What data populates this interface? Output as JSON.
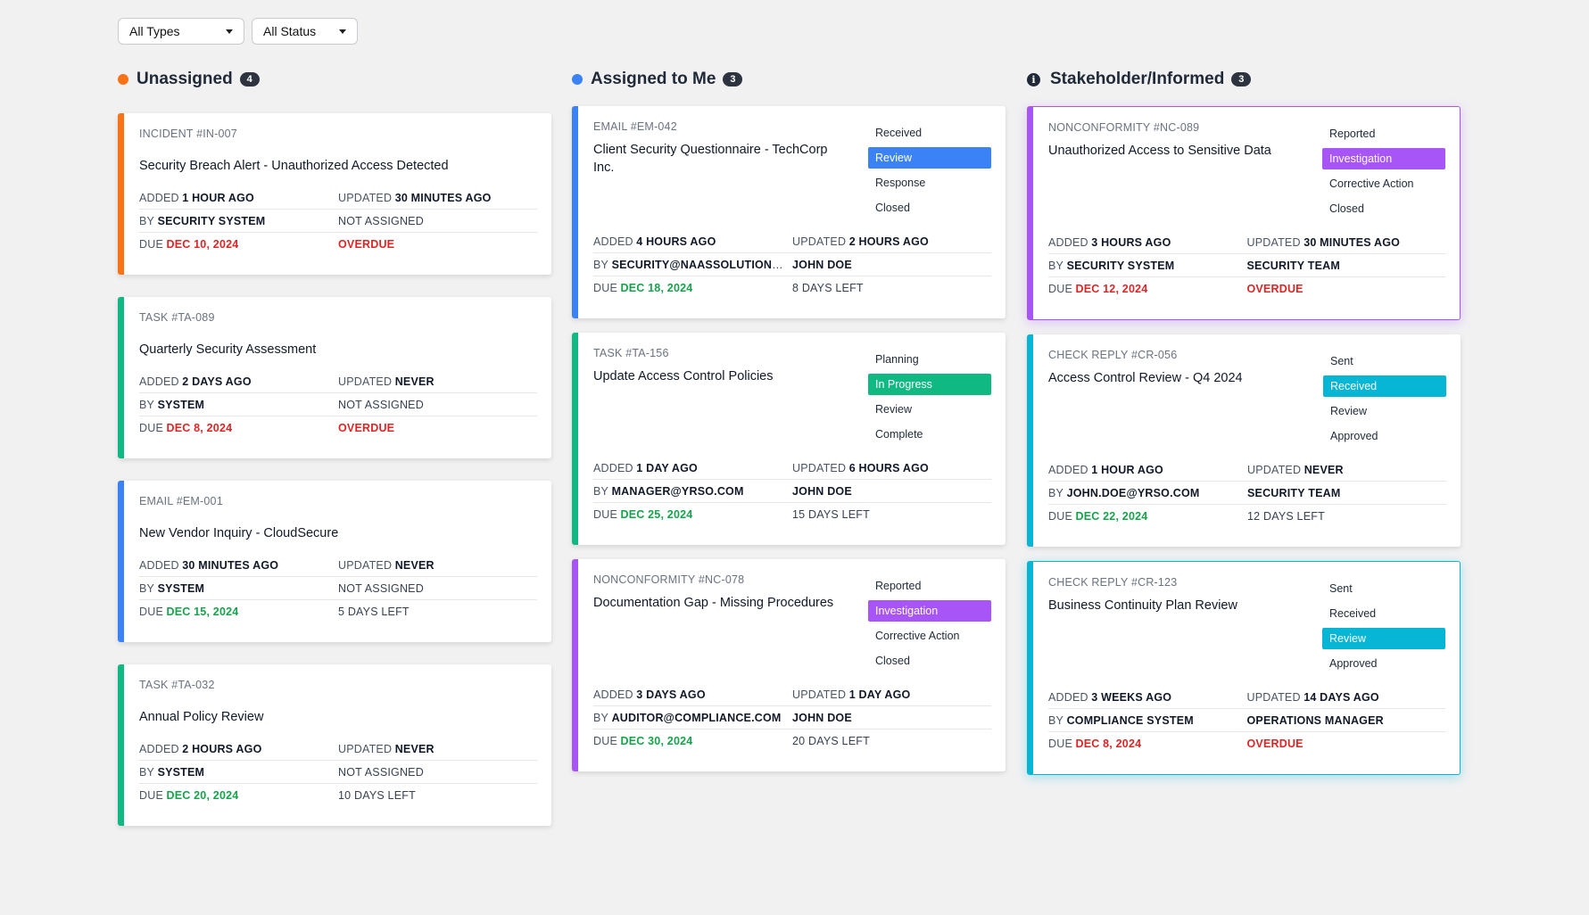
{
  "colors": {
    "orange": "#f97316",
    "blue": "#3b82f6",
    "green": "#10b981",
    "purple": "#a855f7",
    "cyan": "#06b6d4",
    "red": "#dc2626",
    "due_green": "#16a34a"
  },
  "filters": {
    "type": "All Types",
    "status": "All Status"
  },
  "columns": [
    {
      "title": "Unassigned",
      "count": "4",
      "icon": "orange-dot-icon",
      "cards": [
        {
          "id": "INCIDENT #IN-007",
          "title": "Security Breach Alert - Unauthorized Access Detected",
          "added_label": "ADDED",
          "added": "1 HOUR AGO",
          "updated_label": "UPDATED",
          "updated": "30 MINUTES AGO",
          "by_label": "BY",
          "by": "SECURITY SYSTEM",
          "assignee": "NOT ASSIGNED",
          "due_label": "DUE",
          "due": "DEC 10, 2024",
          "status": "OVERDUE"
        },
        {
          "id": "TASK #TA-089",
          "title": "Quarterly Security Assessment",
          "added_label": "ADDED",
          "added": "2 DAYS AGO",
          "updated_label": "UPDATED",
          "updated": "NEVER",
          "by_label": "BY",
          "by": "SYSTEM",
          "assignee": "NOT ASSIGNED",
          "due_label": "DUE",
          "due": "DEC 8, 2024",
          "status": "OVERDUE"
        },
        {
          "id": "EMAIL #EM-001",
          "title": "New Vendor Inquiry - CloudSecure",
          "added_label": "ADDED",
          "added": "30 MINUTES AGO",
          "updated_label": "UPDATED",
          "updated": "NEVER",
          "by_label": "BY",
          "by": "SYSTEM",
          "assignee": "NOT ASSIGNED",
          "due_label": "DUE",
          "due": "DEC 15, 2024",
          "status": "5 DAYS LEFT"
        },
        {
          "id": "TASK #TA-032",
          "title": "Annual Policy Review",
          "added_label": "ADDED",
          "added": "2 HOURS AGO",
          "updated_label": "UPDATED",
          "updated": "NEVER",
          "by_label": "BY",
          "by": "SYSTEM",
          "assignee": "NOT ASSIGNED",
          "due_label": "DUE",
          "due": "DEC 20, 2024",
          "status": "10 DAYS LEFT"
        }
      ]
    },
    {
      "title": "Assigned to Me",
      "count": "3",
      "icon": "blue-dot-icon",
      "cards": [
        {
          "id": "EMAIL #EM-042",
          "title": "Client Security Questionnaire - TechCorp Inc.",
          "steps": [
            "Received",
            "Review",
            "Response",
            "Closed"
          ],
          "active_step": "Review",
          "added_label": "ADDED",
          "added": "4 HOURS AGO",
          "updated_label": "UPDATED",
          "updated": "2 HOURS AGO",
          "by_label": "BY",
          "by": "SECURITY@NAASSOLUTIONS.C...",
          "assignee": "JOHN DOE",
          "due_label": "DUE",
          "due": "DEC 18, 2024",
          "status": "8 DAYS LEFT"
        },
        {
          "id": "TASK #TA-156",
          "title": "Update Access Control Policies",
          "steps": [
            "Planning",
            "In Progress",
            "Review",
            "Complete"
          ],
          "active_step": "In Progress",
          "added_label": "ADDED",
          "added": "1 DAY AGO",
          "updated_label": "UPDATED",
          "updated": "6 HOURS AGO",
          "by_label": "BY",
          "by": "MANAGER@YRSO.COM",
          "assignee": "JOHN DOE",
          "due_label": "DUE",
          "due": "DEC 25, 2024",
          "status": "15 DAYS LEFT"
        },
        {
          "id": "NONCONFORMITY #NC-078",
          "title": "Documentation Gap - Missing Procedures",
          "steps": [
            "Reported",
            "Investigation",
            "Corrective Action",
            "Closed"
          ],
          "active_step": "Investigation",
          "added_label": "ADDED",
          "added": "3 DAYS AGO",
          "updated_label": "UPDATED",
          "updated": "1 DAY AGO",
          "by_label": "BY",
          "by": "AUDITOR@COMPLIANCE.COM",
          "assignee": "JOHN DOE",
          "due_label": "DUE",
          "due": "DEC 30, 2024",
          "status": "20 DAYS LEFT"
        }
      ]
    },
    {
      "title": "Stakeholder/Informed",
      "count": "3",
      "icon": "info-icon",
      "cards": [
        {
          "id": "NONCONFORMITY #NC-089",
          "title": "Unauthorized Access to Sensitive Data",
          "steps": [
            "Reported",
            "Investigation",
            "Corrective Action",
            "Closed"
          ],
          "active_step": "Investigation",
          "added_label": "ADDED",
          "added": "3 HOURS AGO",
          "updated_label": "UPDATED",
          "updated": "30 MINUTES AGO",
          "by_label": "BY",
          "by": "SECURITY SYSTEM",
          "assignee": "SECURITY TEAM",
          "due_label": "DUE",
          "due": "DEC 12, 2024",
          "status": "OVERDUE"
        },
        {
          "id": "CHECK REPLY #CR-056",
          "title": "Access Control Review - Q4 2024",
          "steps": [
            "Sent",
            "Received",
            "Review",
            "Approved"
          ],
          "active_step": "Received",
          "added_label": "ADDED",
          "added": "1 HOUR AGO",
          "updated_label": "UPDATED",
          "updated": "NEVER",
          "by_label": "BY",
          "by": "JOHN.DOE@YRSO.COM",
          "assignee": "SECURITY TEAM",
          "due_label": "DUE",
          "due": "DEC 22, 2024",
          "status": "12 DAYS LEFT"
        },
        {
          "id": "CHECK REPLY #CR-123",
          "title": "Business Continuity Plan Review",
          "steps": [
            "Sent",
            "Received",
            "Review",
            "Approved"
          ],
          "active_step": "Review",
          "added_label": "ADDED",
          "added": "3 WEEKS AGO",
          "updated_label": "UPDATED",
          "updated": "14 DAYS AGO",
          "by_label": "BY",
          "by": "COMPLIANCE SYSTEM",
          "assignee": "OPERATIONS MANAGER",
          "due_label": "DUE",
          "due": "DEC 8, 2024",
          "status": "OVERDUE"
        }
      ]
    }
  ]
}
